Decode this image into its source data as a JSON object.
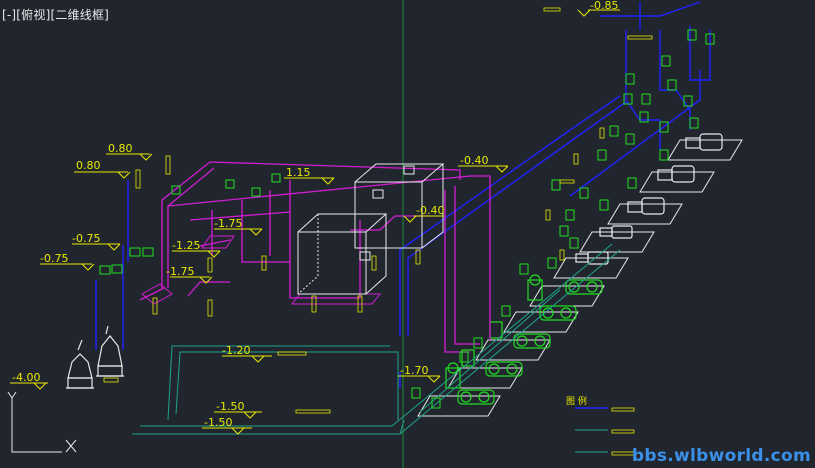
{
  "viewport": {
    "label": "[-][俯视][二维线框]"
  },
  "elevations": {
    "e1": "0.80",
    "e2": "0.80",
    "e3": "-0.75",
    "e4": "-0.75",
    "e5": "-1.25",
    "e6": "-1.75",
    "e7": "-1.75",
    "e8": "1.15",
    "e9": "-0.40",
    "e10": "-0.40",
    "e11": "-0.85",
    "e12": "-1.20",
    "e13": "-1.70",
    "e14": "-1.50",
    "e15": "-1.50",
    "e16": "-4.00"
  },
  "legend": {
    "title": "图 例"
  },
  "watermark": "bbs.wlbworld.com",
  "ucs": {
    "y": "Y",
    "x": "X"
  },
  "colors": {
    "background": "#21262e",
    "pipe_blue": "#2222ff",
    "pipe_magenta": "#d21cd2",
    "pipe_teal": "#1fa38a",
    "equipment_green": "#22dd22",
    "equipment_white": "#e8e8e8",
    "text_yellow": "#e8e800",
    "grid_green": "#1d8a3a"
  }
}
